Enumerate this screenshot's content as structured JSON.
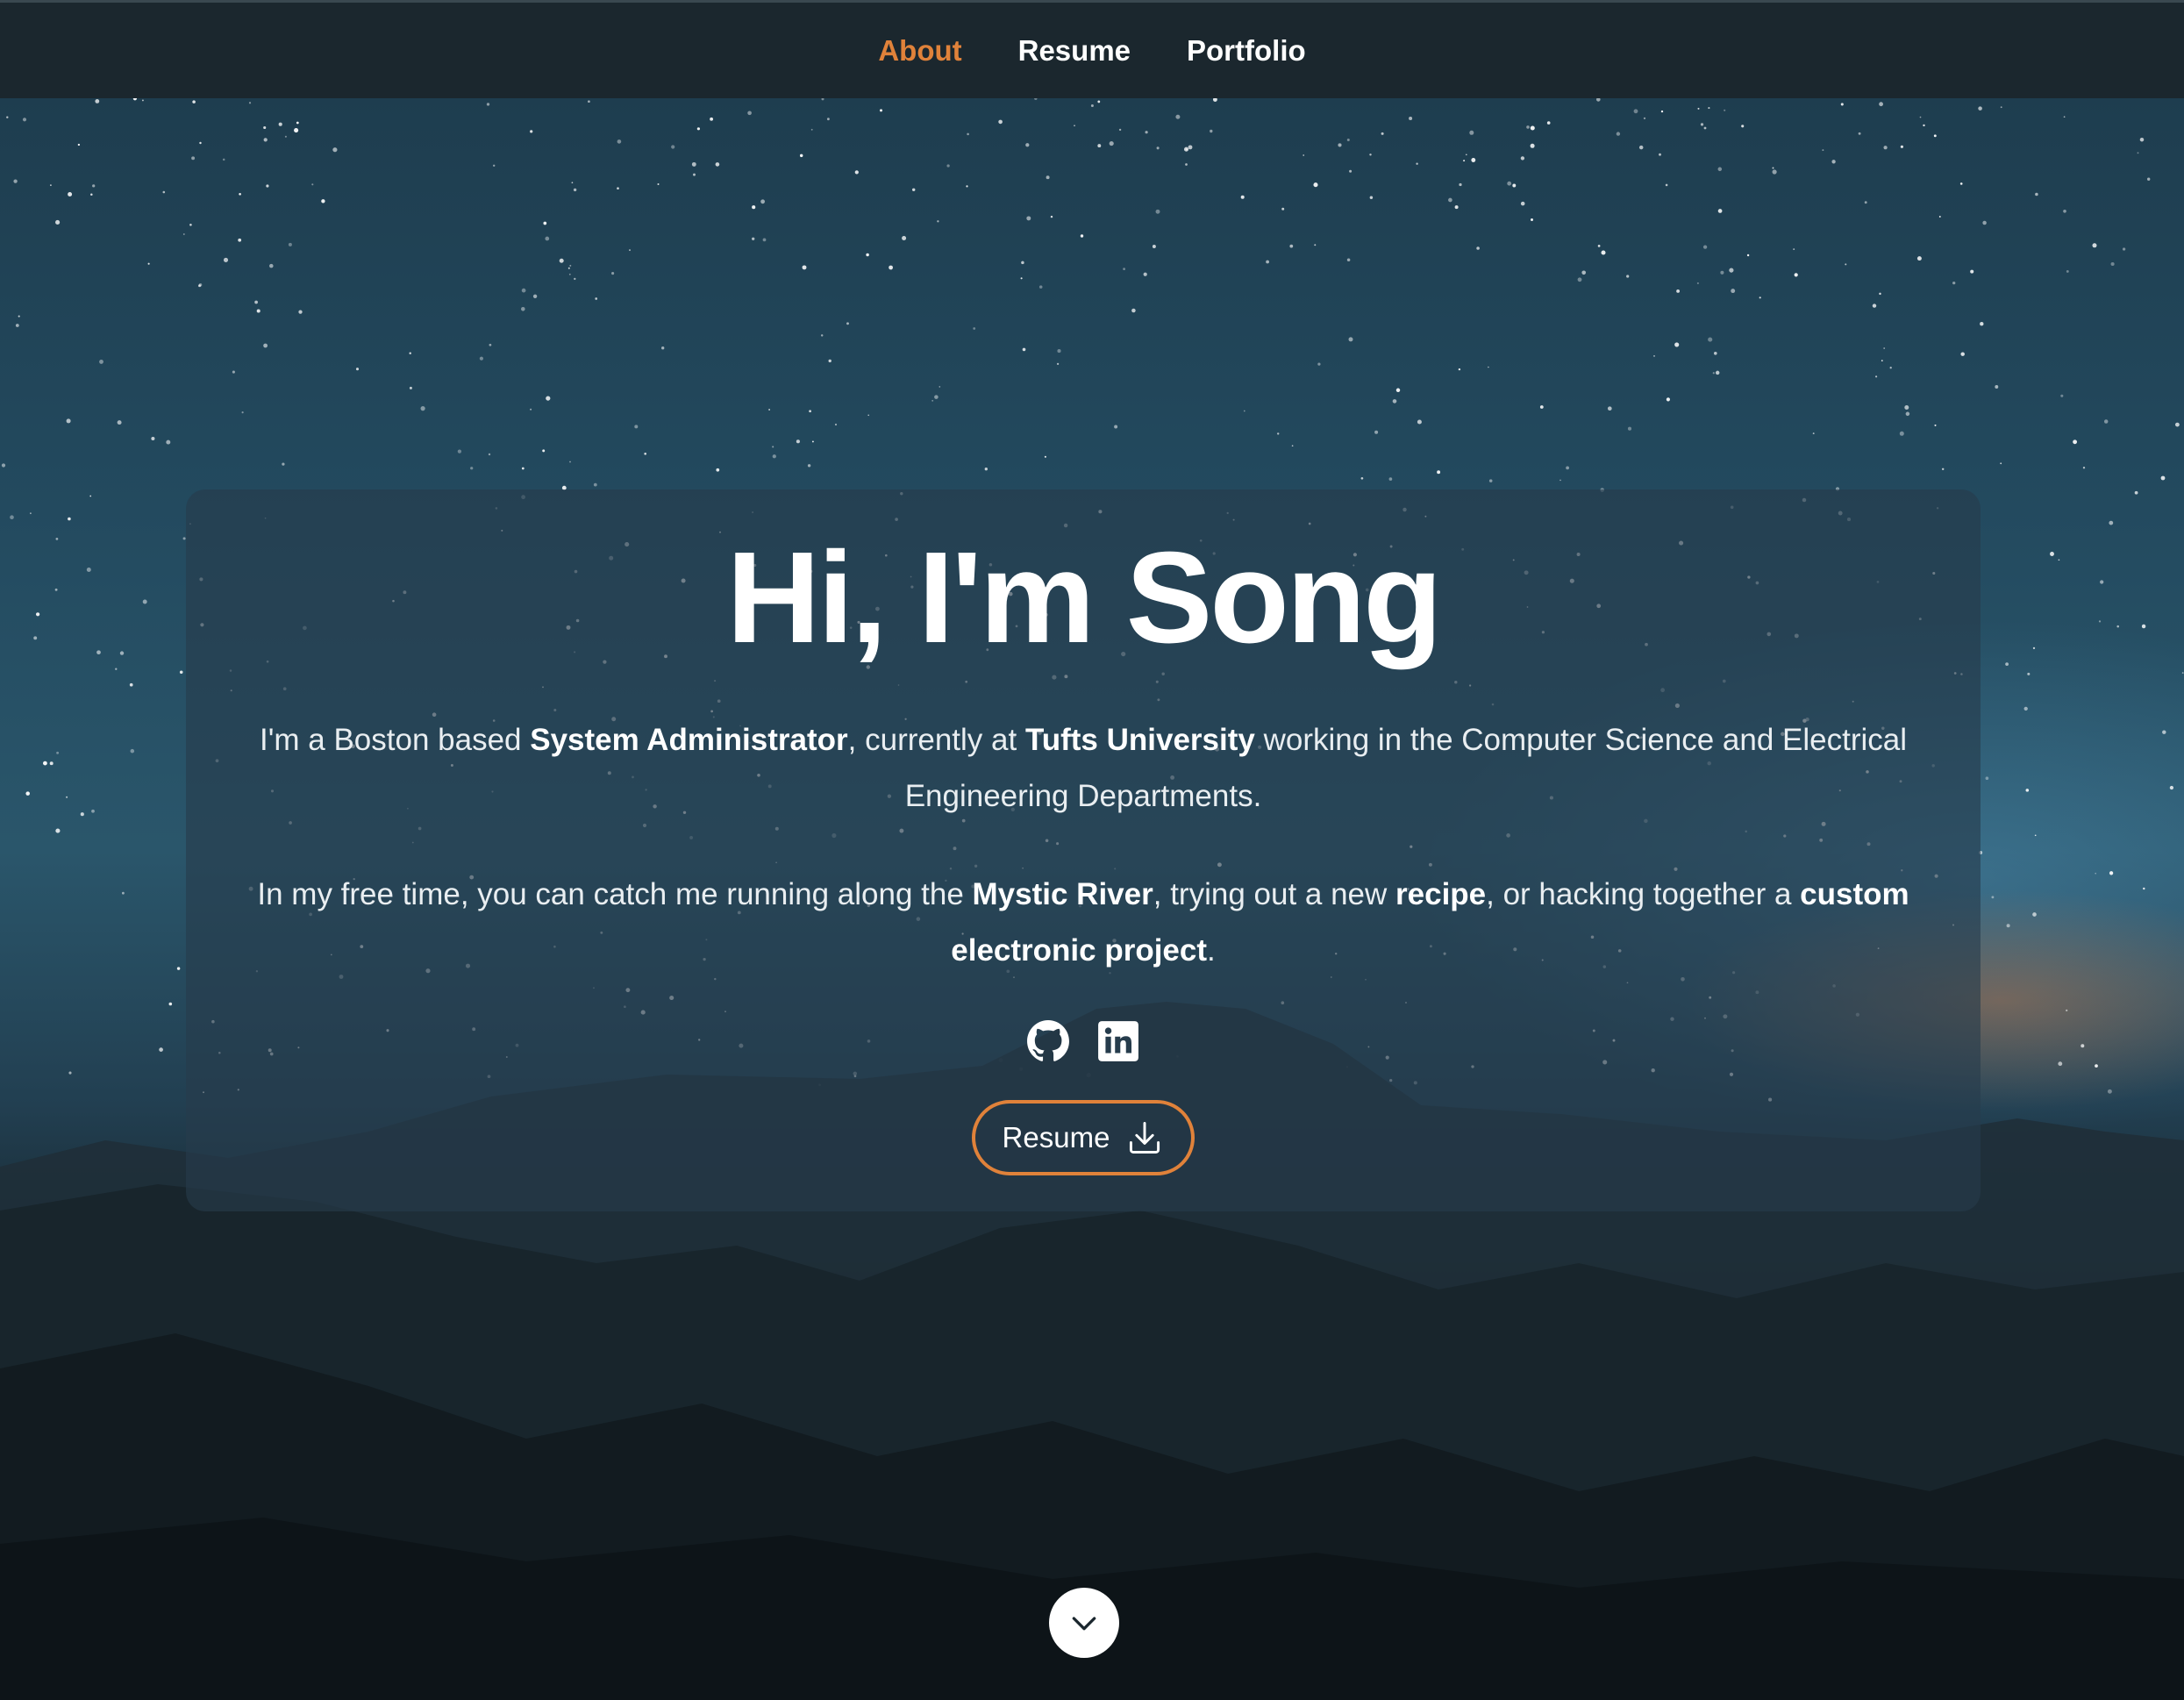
{
  "nav": {
    "items": [
      {
        "label": "About",
        "active": true
      },
      {
        "label": "Resume",
        "active": false
      },
      {
        "label": "Portfolio",
        "active": false
      }
    ]
  },
  "hero": {
    "heading": "Hi, I'm Song",
    "intro": {
      "p1": "I'm a Boston based ",
      "b1": "System Administrator",
      "p2": ", currently at ",
      "b2": "Tufts University",
      "p3": " working in the Computer Science and Electrical Engineering Departments."
    },
    "hobbies": {
      "p1": "In my free time, you can catch me running along the ",
      "b1": "Mystic River",
      "p2": ", trying out a new ",
      "b2": "recipe",
      "p3": ", or hacking together a ",
      "b3": "custom electronic project",
      "p4": "."
    },
    "social": [
      {
        "icon": "github-icon"
      },
      {
        "icon": "linkedin-icon"
      }
    ],
    "resume_button": {
      "label": "Resume",
      "icon": "download-icon"
    },
    "scroll_icon": "chevron-down-icon"
  },
  "colors": {
    "accent": "#e0823a",
    "navbar": "#1b272e",
    "text": "#ffffff"
  }
}
